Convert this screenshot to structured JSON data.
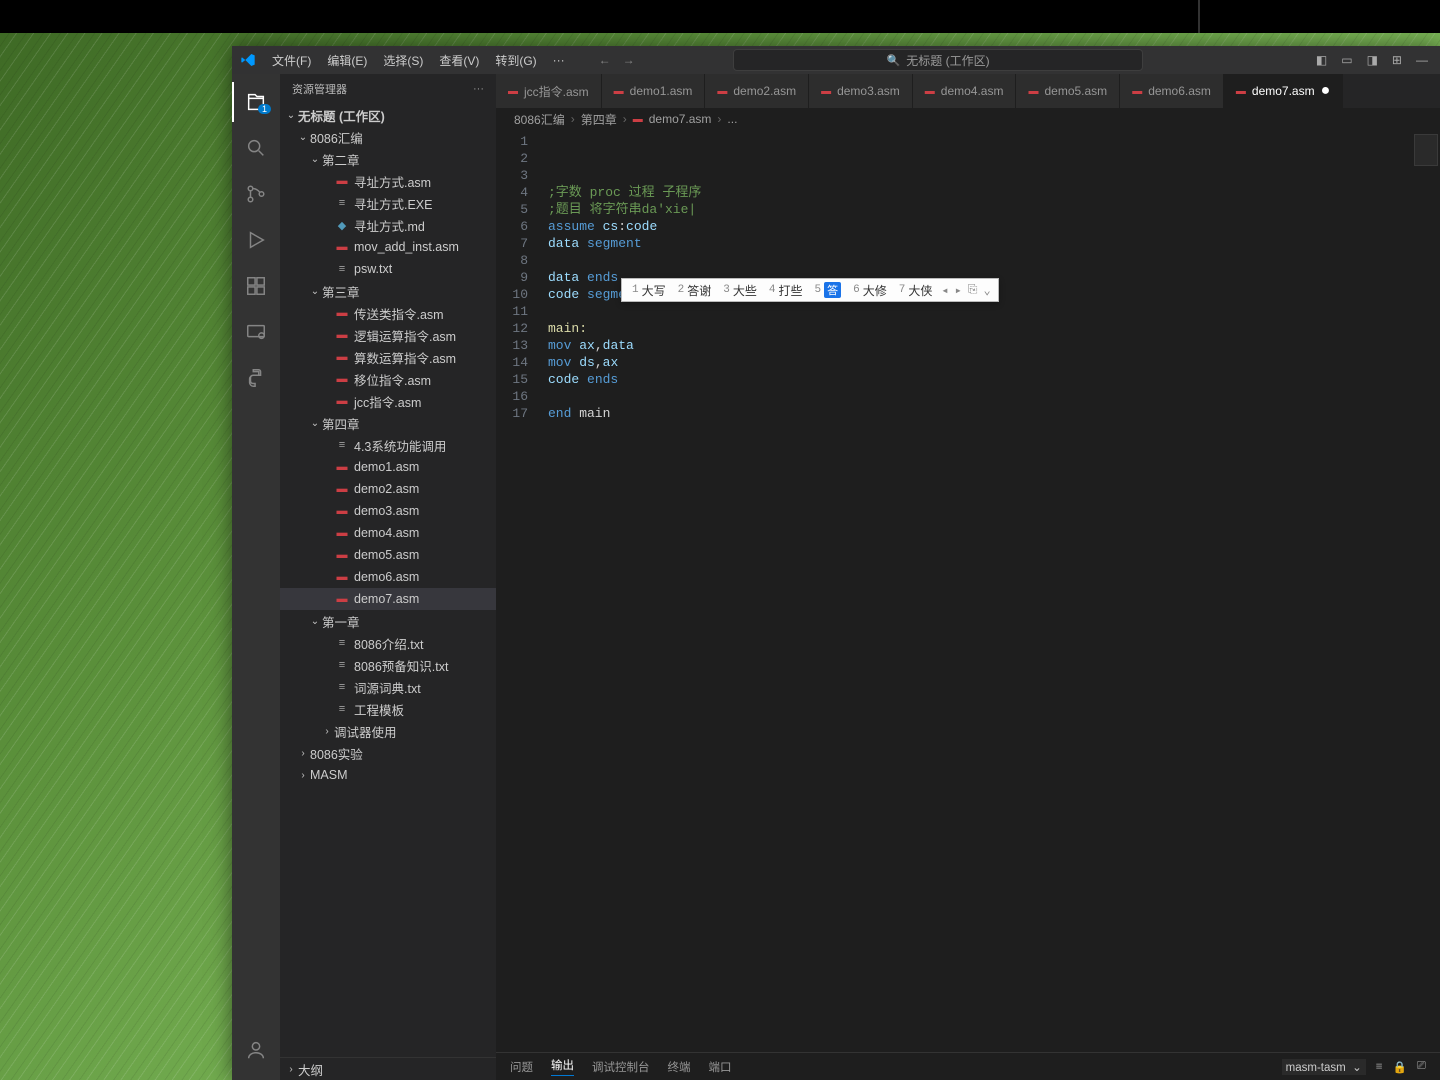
{
  "menu": {
    "file": "文件(F)",
    "edit": "编辑(E)",
    "select": "选择(S)",
    "view": "查看(V)",
    "goto": "转到(G)",
    "more": "···"
  },
  "search_placeholder": "无标题 (工作区)",
  "explorer": {
    "title": "资源管理器",
    "workspace": "无标题 (工作区)",
    "folders": {
      "f0": "8086汇编",
      "ch2": "第二章",
      "ch2_items": [
        "寻址方式.asm",
        "寻址方式.EXE",
        "寻址方式.md",
        "mov_add_inst.asm",
        "psw.txt"
      ],
      "ch3": "第三章",
      "ch3_items": [
        "传送类指令.asm",
        "逻辑运算指令.asm",
        "算数运算指令.asm",
        "移位指令.asm",
        "jcc指令.asm"
      ],
      "ch4": "第四章",
      "ch4_items": [
        "4.3系统功能调用",
        "demo1.asm",
        "demo2.asm",
        "demo3.asm",
        "demo4.asm",
        "demo5.asm",
        "demo6.asm",
        "demo7.asm"
      ],
      "ch1": "第一章",
      "ch1_items": [
        "8086介绍.txt",
        "8086预备知识.txt",
        "词源词典.txt",
        "工程模板",
        "调试器使用"
      ],
      "extra": [
        "8086实验",
        "MASM"
      ]
    },
    "outline": "大纲"
  },
  "tabs": [
    "jcc指令.asm",
    "demo1.asm",
    "demo2.asm",
    "demo3.asm",
    "demo4.asm",
    "demo5.asm",
    "demo6.asm",
    "demo7.asm"
  ],
  "active_tab": "demo7.asm",
  "breadcrumbs": [
    "8086汇编",
    "第四章",
    "demo7.asm",
    "..."
  ],
  "code_lines": [
    "",
    "",
    "",
    ";字数 proc 过程  子程序",
    ";题目 将字符串da'xie|",
    "assume cs:code",
    "data segment",
    "",
    "data ends",
    "code segment",
    "",
    "main:",
    "    mov ax,data",
    "    mov ds,ax",
    "code ends",
    "",
    "end main"
  ],
  "ime": {
    "candidates": [
      {
        "n": "1",
        "t": "大写"
      },
      {
        "n": "2",
        "t": "答谢"
      },
      {
        "n": "3",
        "t": "大些"
      },
      {
        "n": "4",
        "t": "打些"
      },
      {
        "n": "5",
        "t": "答",
        "sel": true
      },
      {
        "n": "6",
        "t": "大修"
      },
      {
        "n": "7",
        "t": "大侠"
      }
    ]
  },
  "panel": {
    "tabs": [
      "问题",
      "输出",
      "调试控制台",
      "终端",
      "端口"
    ],
    "active": "输出",
    "select": "masm-tasm"
  }
}
